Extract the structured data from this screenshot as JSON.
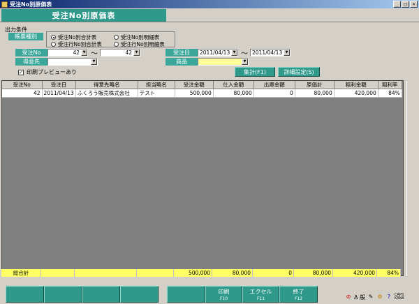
{
  "window": {
    "title": "受注No別原価表",
    "buttons": [
      "_",
      "□",
      "×"
    ]
  },
  "form": {
    "title": "受注No別原価表"
  },
  "conditions": {
    "section_label": "出力条件",
    "report_type_label": "帳票種別",
    "report_types": [
      {
        "label": "受注No別合計表",
        "selected": true
      },
      {
        "label": "受注No別明細表",
        "selected": false
      },
      {
        "label": "受注行No別合計表",
        "selected": false
      },
      {
        "label": "受注行No別明細表",
        "selected": false
      }
    ],
    "order_no_label": "受注No",
    "order_no_from": "42",
    "order_no_to": "42",
    "order_date_label": "受注日",
    "order_date_from": "2011/04/13",
    "order_date_to": "2011/04/13",
    "customer_label": "得意先",
    "customer_value": "",
    "product_label": "商品",
    "product_value": "",
    "tilde": "〜",
    "print_preview_label": "印刷プレビューあり",
    "print_preview_checked": true
  },
  "actions": {
    "aggregate_label": "集計(F1)",
    "detail_settings_label": "詳細設定(S)"
  },
  "table": {
    "columns": [
      "受注No",
      "受注日",
      "得意先略名",
      "担当略名",
      "受注金額",
      "仕入金額",
      "出庫金額",
      "原価計",
      "粗利金額",
      "粗利率"
    ],
    "rows": [
      [
        "42",
        "2011/04/13",
        "ふくろう販売株式会社",
        "テスト",
        "500,000",
        "80,000",
        "0",
        "80,000",
        "420,000",
        "84%"
      ]
    ],
    "total": [
      "総合計",
      "",
      "",
      "",
      "500,000",
      "80,000",
      "0",
      "80,000",
      "420,000",
      "84%"
    ]
  },
  "function_keys": [
    {
      "label": "",
      "key": ""
    },
    {
      "label": "",
      "key": ""
    },
    {
      "label": "",
      "key": ""
    },
    {
      "label": "",
      "key": ""
    },
    {
      "label": "",
      "key": ""
    },
    {
      "label": "印刷",
      "key": "F10"
    },
    {
      "label": "エクセル",
      "key": "F11"
    },
    {
      "label": "終了",
      "key": "F12"
    }
  ],
  "status": {
    "ime_label": "A 般",
    "caps_label": "CAPS",
    "kana_label": "KANA"
  },
  "colors": {
    "accent": "#2f9a8c",
    "total_row": "#ffff66",
    "grid_bg": "#808080"
  }
}
